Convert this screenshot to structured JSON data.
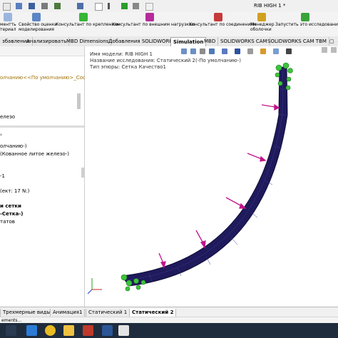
{
  "window": {
    "title": "RIB HIGH 1 *"
  },
  "ribbon": {
    "items": [
      {
        "label1": "ментть",
        "label2": "териал"
      },
      {
        "label1": "Свойство оценки",
        "label2": "моделирования"
      },
      {
        "label1": "Консультант по креплениям",
        "label2": ""
      },
      {
        "label1": "Консультант по внешним нагрузкам",
        "label2": ""
      },
      {
        "label1": "Консультант по соединениям",
        "label2": ""
      },
      {
        "label1": "Менеджер",
        "label2": "оболочки"
      },
      {
        "label1": "Запустить это исследование",
        "label2": ""
      }
    ]
  },
  "tabs": [
    "збавление",
    "Анализировать",
    "MBD Dimensions",
    "Добавления SOLIDWORKS",
    "Simulation",
    "MBD",
    "SOLIDWORKS CAM",
    "SOLIDWORKS CAM TBM"
  ],
  "active_tab": "Simulation",
  "tree": {
    "top_item": "олчанию<<По умолчанию>_Состоя",
    "lines": [
      "елезо",
      "олчанию-)",
      "(Кованное литое железо-)",
      "-1",
      "(ект: 17 N:)",
      "и сетки",
      "-Сетка-)",
      "татов"
    ]
  },
  "viewport": {
    "model_name": "Имя модели: RIB HIGH 1",
    "study_name": "Название исследования: Статический 2(-По умолчанию-)",
    "plot_type": "Тип эпюры: Сетка Качество1"
  },
  "sheet_tabs": [
    "Трехмерные виды",
    "Анимация1",
    "Статический 1",
    "Статический 2"
  ],
  "active_sheet": "Статический 2",
  "status": "ements...",
  "colors": {
    "mesh": "#1f1a5c",
    "fixture": "#3cc43c",
    "load": "#c0138b"
  }
}
